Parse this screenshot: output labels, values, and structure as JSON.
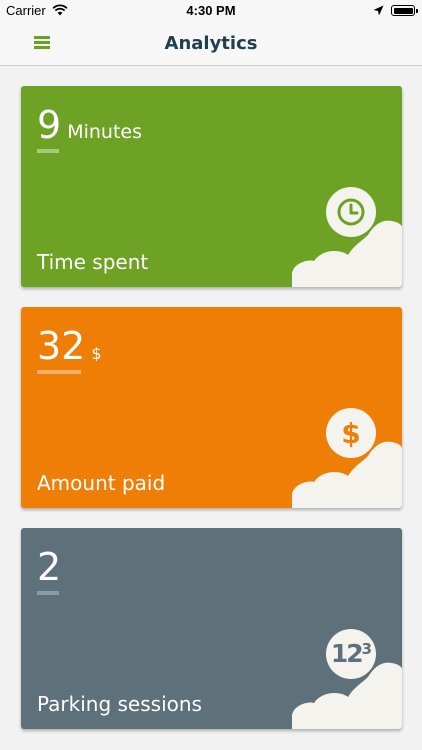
{
  "status_bar": {
    "carrier": "Carrier",
    "time": "4:30 PM"
  },
  "nav": {
    "title": "Analytics",
    "menu_icon": "hamburger-menu-icon"
  },
  "cards": [
    {
      "number": "9",
      "unit": "Minutes",
      "label": "Time spent",
      "icon": "clock-icon",
      "color": "#6ea225",
      "underline_color": "#a8c97a"
    },
    {
      "number": "32",
      "unit": "$",
      "label": "Amount paid",
      "icon": "dollar-icon",
      "color": "#ee7e05",
      "underline_color": "#f4b069"
    },
    {
      "number": "2",
      "unit": "",
      "label": "Parking sessions",
      "icon": "numbers-icon",
      "icon_text_big": "12",
      "icon_text_small": "3",
      "color": "#5e717a",
      "underline_color": "#8e9ca2"
    }
  ],
  "colors": {
    "brand_green": "#6aa125",
    "title": "#1f3f4f",
    "card_accent": "#f4f3ee"
  }
}
